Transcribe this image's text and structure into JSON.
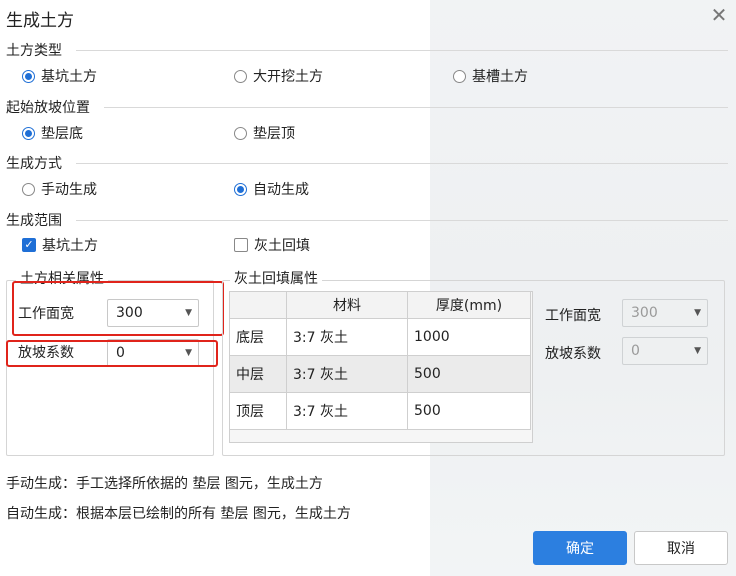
{
  "dialog": {
    "title": "生成土方"
  },
  "earthwork_type": {
    "title": "土方类型",
    "options": [
      {
        "label": "基坑土方",
        "selected": true
      },
      {
        "label": "大开挖土方",
        "selected": false
      },
      {
        "label": "基槽土方",
        "selected": false
      }
    ]
  },
  "slope_start": {
    "title": "起始放坡位置",
    "options": [
      {
        "label": "垫层底",
        "selected": true
      },
      {
        "label": "垫层顶",
        "selected": false
      }
    ]
  },
  "generate_mode": {
    "title": "生成方式",
    "options": [
      {
        "label": "手动生成",
        "selected": false
      },
      {
        "label": "自动生成",
        "selected": true
      }
    ]
  },
  "generate_scope": {
    "title": "生成范围",
    "options": [
      {
        "label": "基坑土方",
        "checked": true
      },
      {
        "label": "灰土回填",
        "checked": false
      }
    ]
  },
  "earthwork_props": {
    "title": "土方相关属性",
    "work_width_label": "工作面宽",
    "work_width_value": "300",
    "slope_coef_label": "放坡系数",
    "slope_coef_value": "0"
  },
  "backfill_props": {
    "title": "灰土回填属性",
    "headers": [
      "",
      "材料",
      "厚度(mm)"
    ],
    "rows": [
      {
        "layer": "底层",
        "material": "3:7 灰土",
        "thickness": "1000"
      },
      {
        "layer": "中层",
        "material": "3:7 灰土",
        "thickness": "500"
      },
      {
        "layer": "顶层",
        "material": "3:7 灰土",
        "thickness": "500"
      }
    ],
    "work_width_label": "工作面宽",
    "work_width_value": "300",
    "slope_coef_label": "放坡系数",
    "slope_coef_value": "0"
  },
  "notes": {
    "manual": "手动生成：手工选择所依据的 垫层 图元，生成土方",
    "auto": "自动生成：根据本层已绘制的所有 垫层 图元，生成土方"
  },
  "buttons": {
    "ok": "确定",
    "cancel": "取消"
  },
  "colors": {
    "accent": "#2c7fe0",
    "highlight": "#e0241b"
  }
}
